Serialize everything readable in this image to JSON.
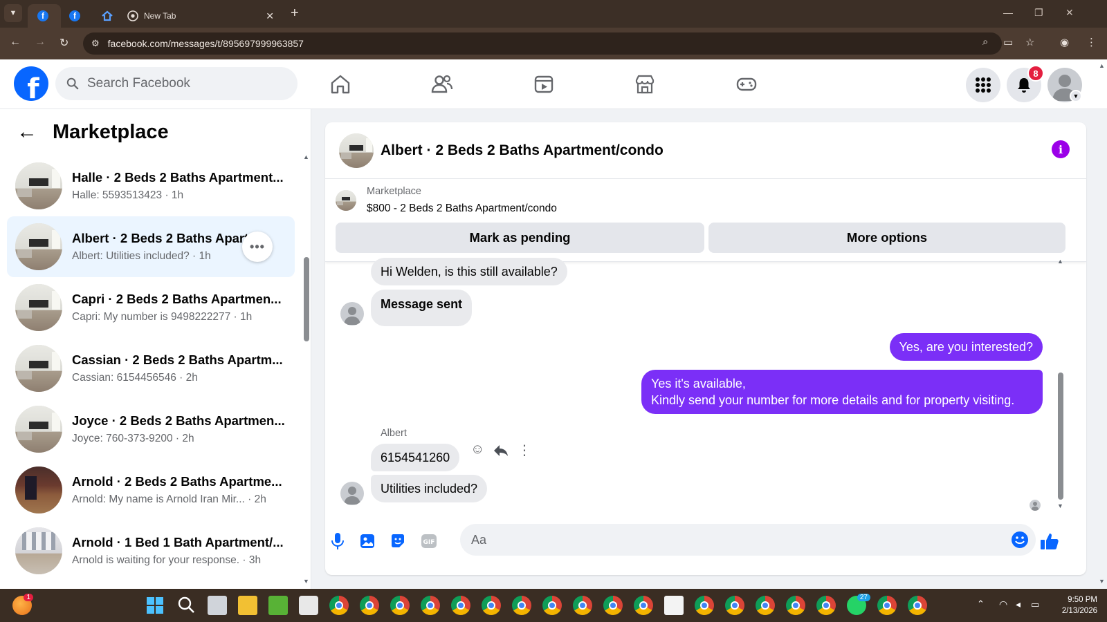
{
  "browser": {
    "tabs": [
      {
        "icon": "facebook-icon",
        "title": ""
      },
      {
        "icon": "facebook-icon",
        "title": ""
      },
      {
        "icon": "zillow-icon",
        "title": ""
      },
      {
        "icon": "chrome-icon",
        "title": "New Tab"
      }
    ],
    "url": "facebook.com/messages/t/895697999963857"
  },
  "fb_header": {
    "logo": "f",
    "search_placeholder": "Search Facebook",
    "notification_count": "8",
    "nav": [
      "home-icon",
      "friends-icon",
      "video-icon",
      "marketplace-icon",
      "gaming-icon"
    ]
  },
  "sidebar": {
    "title": "Marketplace",
    "conversations": [
      {
        "name": "Halle · 2 Beds 2 Baths Apartment...",
        "preview": "Halle: 5593513423 · 1h"
      },
      {
        "name": "Albert · 2 Beds 2 Baths Apartm...",
        "preview": "Albert: Utilities included? · 1h"
      },
      {
        "name": "Capri · 2 Beds 2 Baths Apartmen...",
        "preview": "Capri: My number is 9498222277 · 1h"
      },
      {
        "name": "Cassian · 2 Beds 2 Baths Apartm...",
        "preview": "Cassian: 6154456546 · 2h"
      },
      {
        "name": "Joyce · 2 Beds 2 Baths Apartmen...",
        "preview": "Joyce: 760-373-9200 · 2h"
      },
      {
        "name": "Arnold · 2 Beds 2 Baths Apartme...",
        "preview": "Arnold: My name is Arnold Iran Mir... · 2h"
      },
      {
        "name": "Arnold · 1 Bed 1 Bath Apartment/...",
        "preview": "Arnold is waiting for your response. · 3h"
      }
    ],
    "more_label": "•••"
  },
  "chat": {
    "title": "Albert · 2 Beds 2 Baths Apartment/condo",
    "listing": {
      "label": "Marketplace",
      "title": "$800 - 2 Beds 2 Baths Apartment/condo",
      "mark_pending": "Mark as pending",
      "more_options": "More options"
    },
    "messages": [
      {
        "dir": "in",
        "text": "Hi Welden, is this still available?"
      },
      {
        "dir": "in",
        "text": "Message sent"
      },
      {
        "dir": "out",
        "text": "Yes, are you interested?"
      },
      {
        "dir": "out",
        "text": "Yes it's available,"
      },
      {
        "dir": "out",
        "text": "Kindly send your number for more details and for property visiting."
      },
      {
        "dir": "in",
        "text": "6154541260"
      },
      {
        "dir": "in",
        "text": "Utilities included?"
      }
    ],
    "sender_label": "Albert",
    "composer_placeholder": "Aa"
  },
  "taskbar": {
    "time": "9:50 PM",
    "date": "2/13/2026",
    "whatsapp_badge": "27",
    "notif_badge": "1"
  },
  "colors": {
    "fb_blue": "#0866ff",
    "chat_accent": "#7b2ff7",
    "info_purple": "#9b00e8",
    "badge_red": "#e41e3f"
  }
}
